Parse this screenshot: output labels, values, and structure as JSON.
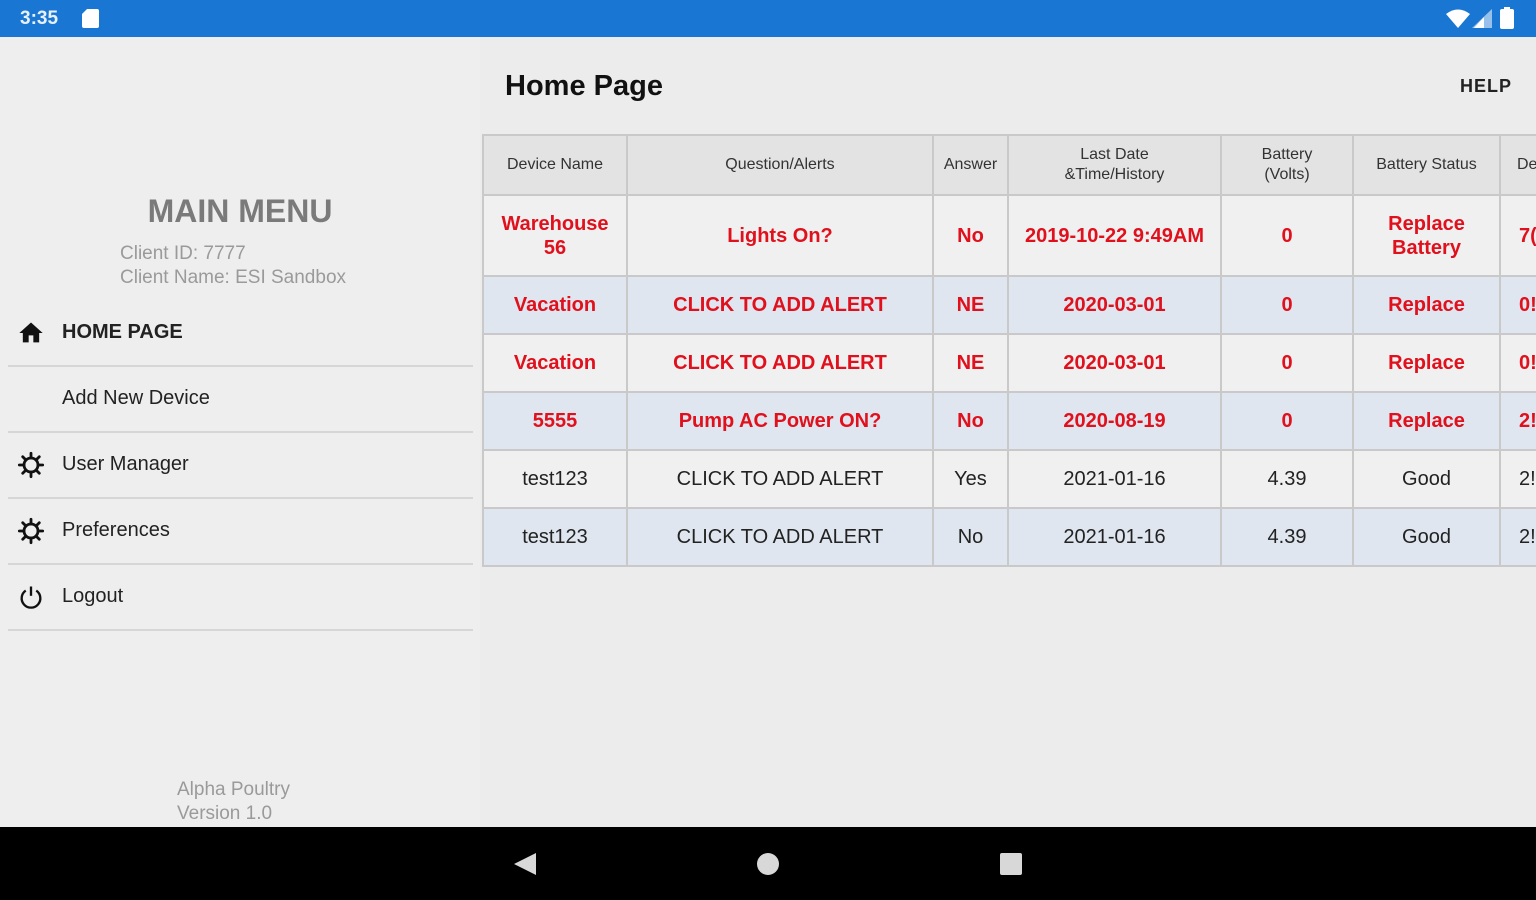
{
  "status_bar": {
    "time": "3:35",
    "icons": [
      "sd-card-icon",
      "wifi-icon",
      "signal-icon",
      "battery-icon"
    ]
  },
  "sidebar": {
    "title": "MAIN MENU",
    "client_id": "Client ID: 7777",
    "client_name": "Client Name: ESI Sandbox",
    "items": [
      {
        "label": "HOME PAGE",
        "icon": "home-icon"
      },
      {
        "label": "Add New Device",
        "icon": ""
      },
      {
        "label": "User Manager",
        "icon": "gear-icon"
      },
      {
        "label": "Preferences",
        "icon": "gear-icon"
      },
      {
        "label": "Logout",
        "icon": "power-icon"
      }
    ],
    "footer_app": "Alpha Poultry",
    "footer_version": "Version 1.0"
  },
  "header": {
    "title": "Home Page",
    "help_label": "HELP"
  },
  "table": {
    "columns": [
      "Device Name",
      "Question/Alerts",
      "Answer",
      "Last Date &Time/History",
      "Battery (Volts)",
      "Battery Status",
      "De"
    ],
    "rows": [
      {
        "cells": [
          "Warehouse 56",
          "Lights On?",
          "No",
          "2019-10-22 9:49AM",
          "0",
          "Replace Battery",
          "7("
        ],
        "alert": true
      },
      {
        "cells": [
          "Vacation",
          "CLICK TO ADD ALERT",
          "NE",
          "2020-03-01",
          "0",
          "Replace",
          "0!"
        ],
        "alert": true
      },
      {
        "cells": [
          "Vacation",
          "CLICK TO ADD ALERT",
          "NE",
          "2020-03-01",
          "0",
          "Replace",
          "0!"
        ],
        "alert": true
      },
      {
        "cells": [
          "5555",
          "Pump AC Power ON?",
          "No",
          "2020-08-19",
          "0",
          "Replace",
          "2!"
        ],
        "alert": true
      },
      {
        "cells": [
          "test123",
          "CLICK TO ADD ALERT",
          "Yes",
          "2021-01-16",
          "4.39",
          "Good",
          "2!"
        ],
        "alert": false
      },
      {
        "cells": [
          "test123",
          "CLICK TO ADD ALERT",
          "No",
          "2021-01-16",
          "4.39",
          "Good",
          "2!"
        ],
        "alert": false
      }
    ]
  },
  "colors": {
    "status_bar": "#1976d2",
    "alert_text": "#e0101c",
    "row_shade": "#dfe6ef"
  }
}
